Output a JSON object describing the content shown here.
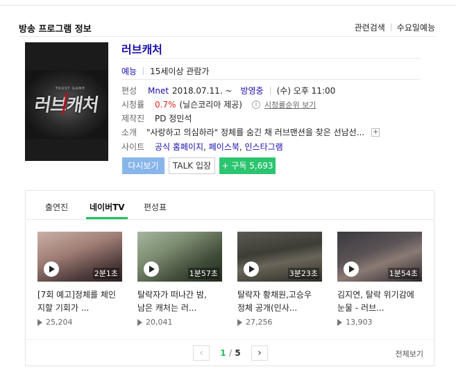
{
  "header": {
    "section_title": "방송 프로그램 정보",
    "links": [
      "관련검색",
      "수요일예능"
    ]
  },
  "program": {
    "title": "러브캐처",
    "genre": "예능",
    "rating_age": "15세이상 관람가",
    "schedule": {
      "label": "편성",
      "channel": "Mnet",
      "date": "2018.07.11. ~",
      "status": "방영중",
      "time": "(수) 오후 11:00"
    },
    "viewership": {
      "label": "시청률",
      "value": "0.7%",
      "source": "(닐슨코리아 제공)",
      "rank_link": "시청률순위 보기"
    },
    "producer": {
      "label": "제작진",
      "value": "PD 정민석"
    },
    "intro": {
      "label": "소개",
      "value": "\"사랑하고 의심하라\" 정체를 숨긴 채 러브맨션을 찾은 선남선..."
    },
    "sites": {
      "label": "사이트",
      "items": [
        "공식 홈페이지",
        "페이스북",
        "인스타그램"
      ]
    }
  },
  "poster": {
    "logo_text": "러브캐처",
    "sub_text": "TRUST GAME"
  },
  "buttons": {
    "replay": "다시보기",
    "talk": "TALK 입장",
    "subscribe": "+ 구독 5,693"
  },
  "tabs": [
    {
      "label": "출연진",
      "active": false
    },
    {
      "label": "네이버TV",
      "active": true
    },
    {
      "label": "편성표",
      "active": false
    }
  ],
  "videos": [
    {
      "title_lines": [
        "[7회 예고]정체를 체인",
        "지할 기회가 ..."
      ],
      "duration": "2분1초",
      "views": "25,204"
    },
    {
      "title_lines": [
        "탈락자가 떠나간 밤,",
        "남은 캐처는 러..."
      ],
      "duration": "1분57초",
      "views": "20,041"
    },
    {
      "title_lines": [
        "탈락자 황채원,고승우",
        "정체 공개(인사..."
      ],
      "duration": "3분23초",
      "views": "27,256"
    },
    {
      "title_lines": [
        "김지연, 탈락 위기감에",
        "눈물 - 러브..."
      ],
      "duration": "1분54초",
      "views": "13,903"
    }
  ],
  "pager": {
    "current": "1",
    "total": "5",
    "view_all": "전체보기"
  },
  "colors": {
    "link": "#1a0dab",
    "accent_green": "#1fbf5f",
    "subscribe_green": "#2bc56f",
    "replay_blue": "#88b5ea",
    "rating_red": "#e0251f"
  }
}
